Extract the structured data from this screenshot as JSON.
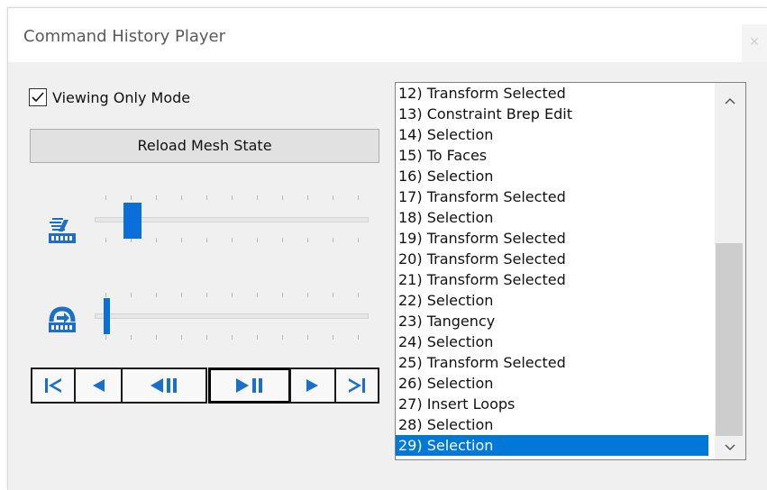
{
  "window": {
    "title": "Command History Player",
    "close_glyph": "✕"
  },
  "viewing_only": {
    "label": "Viewing Only Mode",
    "checked": true
  },
  "reload_button": {
    "label": "Reload Mesh State"
  },
  "sliders": [
    {
      "name": "playback-speed-slider",
      "icon": "playback-speed-icon",
      "value_fraction": 0.08
    },
    {
      "name": "history-position-slider",
      "icon": "history-position-icon",
      "value_fraction": 0.0
    }
  ],
  "transport": {
    "buttons": [
      {
        "name": "go-to-start-button",
        "icon": "skip-to-start-icon"
      },
      {
        "name": "step-back-button",
        "icon": "step-back-icon"
      },
      {
        "name": "play-reverse-button",
        "icon": "play-reverse-icon"
      },
      {
        "name": "play-pause-button",
        "icon": "play-pause-icon",
        "active": true
      },
      {
        "name": "step-forward-button",
        "icon": "step-forward-icon"
      },
      {
        "name": "go-to-end-button",
        "icon": "skip-to-end-icon"
      }
    ]
  },
  "history": {
    "items": [
      "12) Transform Selected",
      "13) Constraint Brep Edit",
      "14) Selection",
      "15) To Faces",
      "16) Selection",
      "17) Transform Selected",
      "18) Selection",
      "19) Transform Selected",
      "20) Transform Selected",
      "21) Transform Selected",
      "22) Selection",
      "23) Tangency",
      "24) Selection",
      "25) Transform Selected",
      "26) Selection",
      "27) Insert Loops",
      "28) Selection",
      "29) Selection"
    ],
    "selected_index": 17
  },
  "colors": {
    "accent": "#0078d7",
    "thumb": "#0a6fd8"
  }
}
